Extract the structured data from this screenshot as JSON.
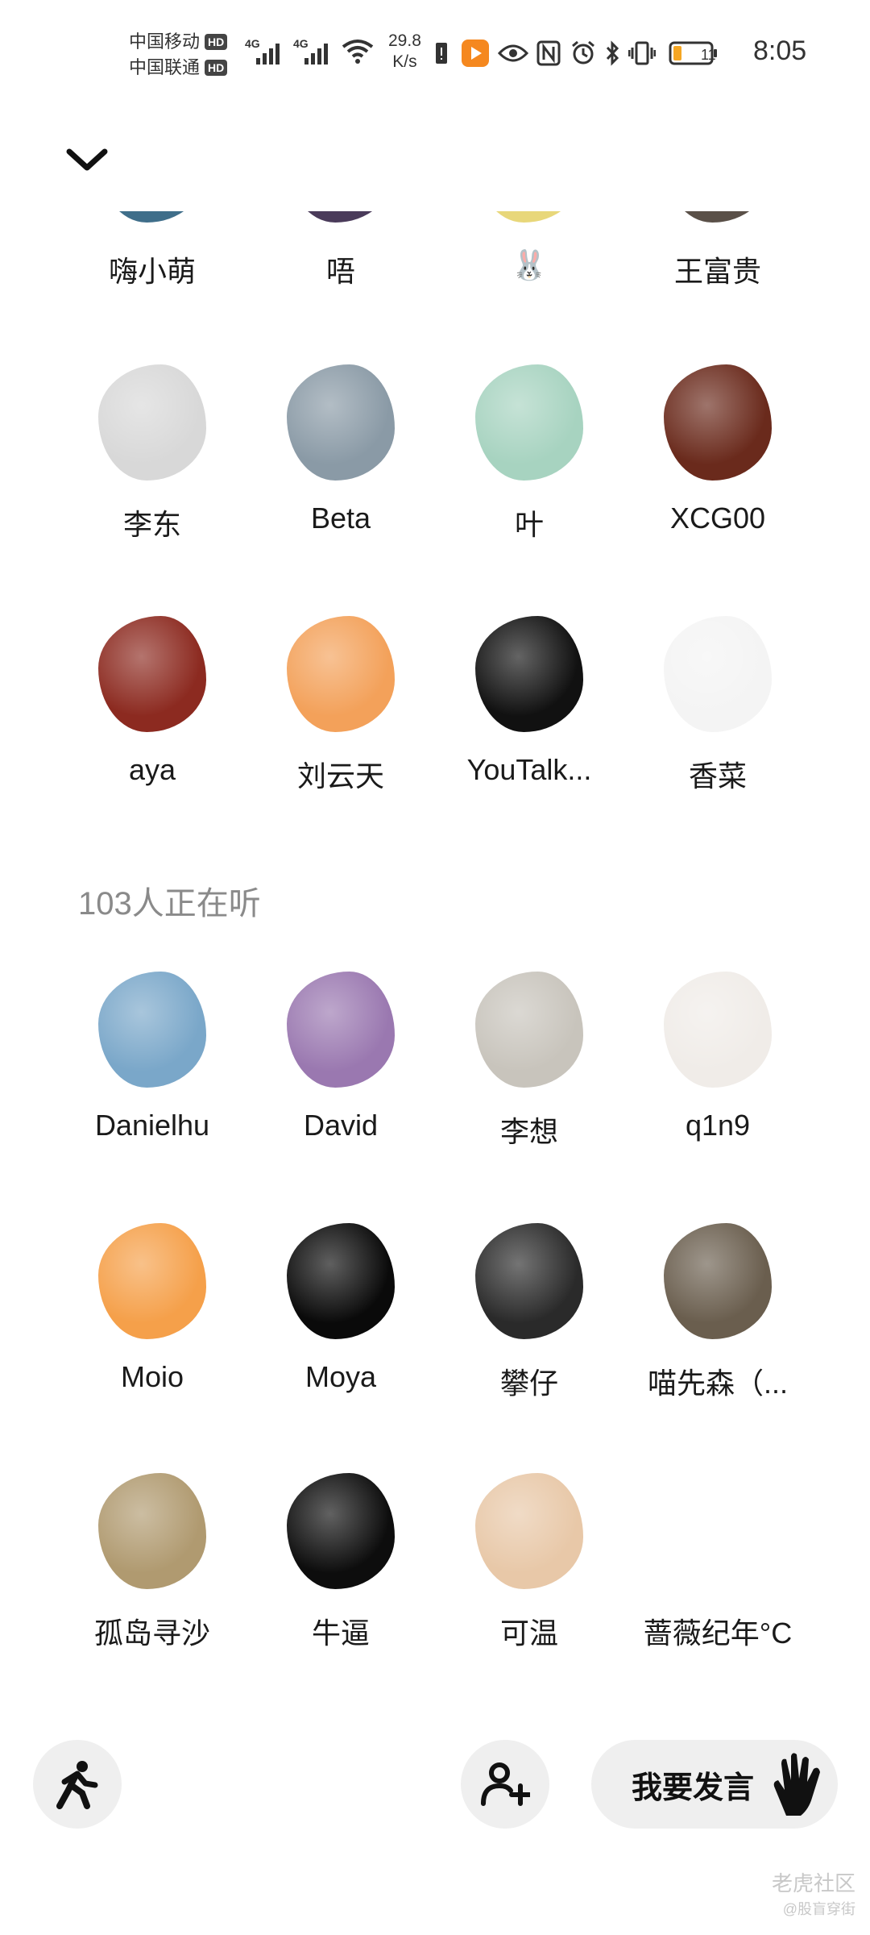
{
  "status_bar": {
    "carrier_1": "中国移动",
    "carrier_2": "中国联通",
    "hd_badge": "HD",
    "network_1": "4G",
    "network_2": "4G",
    "speed_value": "29.8",
    "speed_unit": "K/s",
    "battery": "11",
    "time": "8:05",
    "icons": [
      "warning-icon",
      "video-app-icon",
      "eye-icon",
      "nfc-icon",
      "alarm-icon",
      "bluetooth-icon",
      "vibrate-icon",
      "battery-icon"
    ]
  },
  "speakers": [
    {
      "name": "嗨小萌",
      "color": "#3f6e8a"
    },
    {
      "name": "唔",
      "color": "#4a3b5a"
    },
    {
      "name": "🐰",
      "color": "#e8d77a"
    },
    {
      "name": "王富贵",
      "color": "#5a5048"
    },
    {
      "name": "李东",
      "color": "#d8d8d8"
    },
    {
      "name": "Beta",
      "color": "#8a9aa6"
    },
    {
      "name": "叶",
      "color": "#a7d3c0"
    },
    {
      "name": "XCG00",
      "color": "#6a2a1c"
    },
    {
      "name": "aya",
      "color": "#8c2a20"
    },
    {
      "name": "刘云天",
      "color": "#f3a15a"
    },
    {
      "name": "YouTalk...",
      "color": "#111111"
    },
    {
      "name": "香菜",
      "color": "#f4f4f4"
    }
  ],
  "listeners_label": "103人正在听",
  "listeners": [
    {
      "name": "Danielhu",
      "color": "#7aa7c9"
    },
    {
      "name": "David",
      "color": "#9a78b0"
    },
    {
      "name": "李想",
      "color": "#c8c4bc"
    },
    {
      "name": "q1n9",
      "color": "#f0ece8"
    },
    {
      "name": "Moio",
      "color": "#f5a04a"
    },
    {
      "name": "Moya",
      "color": "#0a0a0a"
    },
    {
      "name": "攀仔",
      "color": "#2a2a2a"
    },
    {
      "name": "喵先森（...",
      "color": "#6a5e4e"
    },
    {
      "name": "孤岛寻沙",
      "color": "#b09a70"
    },
    {
      "name": "牛逼",
      "color": "#0d0d0d"
    },
    {
      "name": "可温",
      "color": "#e8c8a8"
    },
    {
      "name": "蔷薇纪年°C",
      "color": "#ffffff"
    }
  ],
  "bottom_bar": {
    "speak_label": "我要发言",
    "leave_icon": "walking-person-icon",
    "invite_icon": "add-user-icon",
    "hand_icon": "raised-hand-icon"
  },
  "watermark": {
    "text": "老虎社区",
    "sub": "@股盲穿街"
  }
}
